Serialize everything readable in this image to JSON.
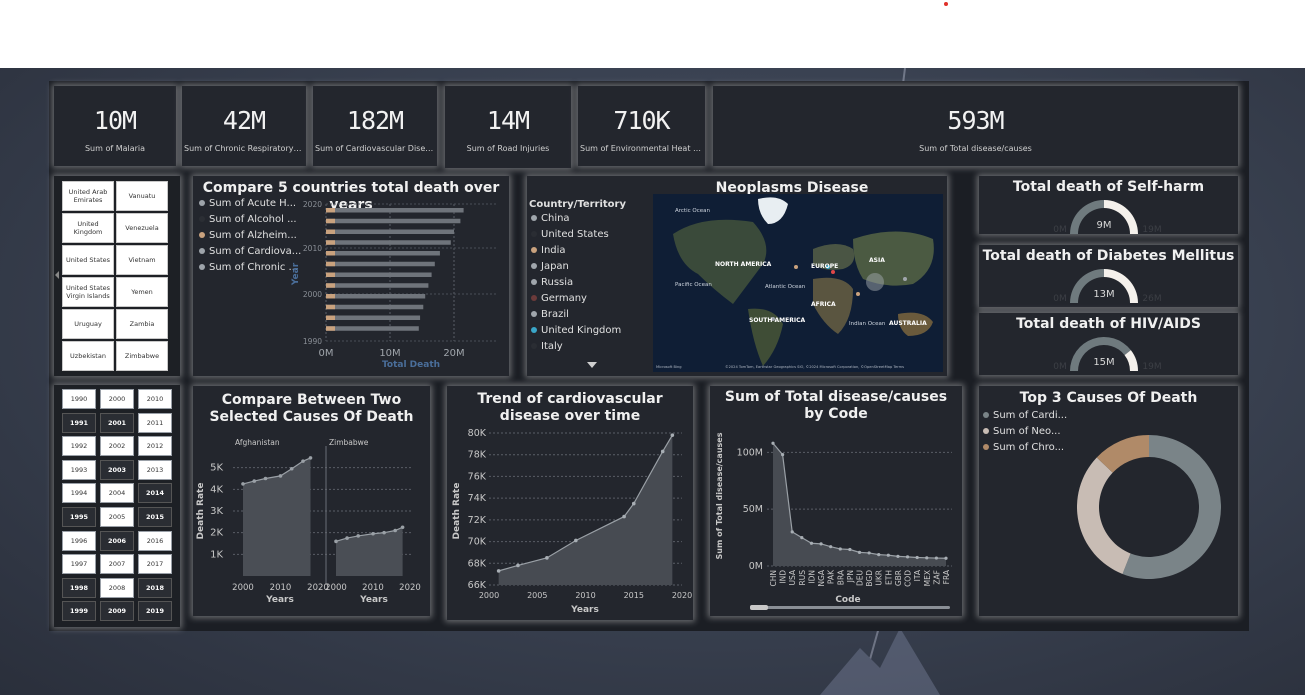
{
  "kpis": [
    {
      "value": "10M",
      "label": "Sum of Malaria"
    },
    {
      "value": "42M",
      "label": "Sum of Chronic Respiratory Dise..."
    },
    {
      "value": "182M",
      "label": "Sum of Cardiovascular Diseases"
    },
    {
      "value": "14M",
      "label": "Sum of Road Injuries"
    },
    {
      "value": "710K",
      "label": "Sum of Environmental Heat and ..."
    },
    {
      "value": "593M",
      "label": "Sum of Total disease/causes"
    }
  ],
  "country_slicer": [
    [
      "United Arab Emirates",
      "Vanuatu"
    ],
    [
      "United Kingdom",
      "Venezuela"
    ],
    [
      "United States",
      "Vietnam"
    ],
    [
      "United States Virgin Islands",
      "Yemen"
    ],
    [
      "Uruguay",
      "Zambia"
    ],
    [
      "Uzbekistan",
      "Zimbabwe"
    ]
  ],
  "year_slicer": {
    "col1": [
      "1990",
      "1991",
      "1992",
      "1993",
      "1994",
      "1995",
      "1996",
      "1997",
      "1998",
      "1999"
    ],
    "col2": [
      "2000",
      "2001",
      "2002",
      "2003",
      "2004",
      "2005",
      "2006",
      "2007",
      "2008",
      "2009"
    ],
    "col3": [
      "2010",
      "2011",
      "2012",
      "2013",
      "2014",
      "2015",
      "2016",
      "2017",
      "2018",
      "2019"
    ],
    "selected": [
      "1991",
      "1995",
      "1998",
      "1999",
      "2001",
      "2003",
      "2006",
      "2009",
      "2014",
      "2015",
      "2018",
      "2019"
    ]
  },
  "compare5": {
    "title": "Compare 5 countries total death over years",
    "legend": [
      "Sum of Acute H...",
      "Sum of Alcohol ...",
      "Sum of Alzheim...",
      "Sum of Cardiova...",
      "Sum of Chronic ..."
    ],
    "legend_colors": [
      "#9ea4aa",
      "#2b2e34",
      "#c9a27e",
      "#9ea4aa",
      "#9ea4aa"
    ],
    "y_label": "Year",
    "x_label": "Total Death",
    "y_ticks": [
      "2020",
      "2010",
      "2000",
      "1990"
    ],
    "x_ticks": [
      "0M",
      "10M",
      "20M"
    ]
  },
  "neoplasms": {
    "title": "Neoplasms Disease",
    "legend_title": "Country/Territory",
    "countries": [
      "China",
      "United States",
      "India",
      "Japan",
      "Russia",
      "Germany",
      "Brazil",
      "United Kingdom",
      "Italy"
    ],
    "country_colors": [
      "#a0a6ac",
      "#2a2d33",
      "#c9a27e",
      "#a0a6ac",
      "#a0a6ac",
      "#6b3a3a",
      "#a0a6ac",
      "#3aa6c8",
      "#2a2d33"
    ],
    "map_labels": [
      "Arctic Ocean",
      "NORTH AMERICA",
      "EUROPE",
      "ASIA",
      "Pacific Ocean",
      "Atlantic Ocean",
      "AFRICA",
      "SOUTH AMERICA",
      "Indian Ocean",
      "AUSTRALIA"
    ],
    "attribution": "©2024 TomTom, Earthstar Geographics SIO, ©2024 Microsoft Corporation, ©OpenStreetMap  Terms",
    "bing": "Microsoft Bing"
  },
  "gauges": [
    {
      "title": "Total death of Self-harm",
      "value": "9M",
      "min": "0M",
      "max": "19M",
      "fill": 0.5
    },
    {
      "title": "Total death of Diabetes Mellitus",
      "value": "13M",
      "min": "0M",
      "max": "26M",
      "fill": 0.5
    },
    {
      "title": "Total death of HIV/AIDS",
      "value": "15M",
      "min": "0M",
      "max": "19M",
      "fill": 0.79
    }
  ],
  "two_causes": {
    "title": "Compare Between Two Selected Causes Of Death",
    "left_country": "Afghanistan",
    "right_country": "Zimbabwe",
    "y_label": "Death Rate",
    "x_label": "Years",
    "y_ticks": [
      "5K",
      "4K",
      "3K",
      "2K",
      "1K"
    ],
    "x_ticks_left": [
      "2000",
      "2010",
      "2020"
    ],
    "x_ticks_right": [
      "2000",
      "2010",
      "2020"
    ]
  },
  "trend": {
    "title": "Trend of cardiovascular disease over time",
    "y_label": "Death Rate",
    "x_label": "Years",
    "y_ticks": [
      "80K",
      "78K",
      "76K",
      "74K",
      "72K",
      "70K",
      "68K",
      "66K"
    ],
    "x_ticks": [
      "2000",
      "2005",
      "2010",
      "2015",
      "2020"
    ]
  },
  "by_code": {
    "title": "Sum of Total disease/causes by Code",
    "y_label": "Sum of Total disease/causes",
    "x_label": "Code",
    "y_ticks": [
      "100M",
      "50M",
      "0M"
    ],
    "codes": [
      "CHN",
      "IND",
      "USA",
      "RUS",
      "IDN",
      "NGA",
      "PAK",
      "BRA",
      "JPN",
      "DEU",
      "BGD",
      "UKR",
      "ETH",
      "GBR",
      "COD",
      "ITA",
      "MEX",
      "ZAF",
      "FRA"
    ]
  },
  "top3": {
    "title": "Top 3 Causes Of Death",
    "legend": [
      "Sum of Cardi...",
      "Sum of Neo...",
      "Sum of Chro..."
    ],
    "colors": [
      "#7a8488",
      "#c8bcb4",
      "#b08a68"
    ]
  },
  "chart_data": [
    {
      "type": "bar",
      "title": "Compare 5 countries total death over years",
      "xlabel": "Total Death",
      "ylabel": "Year",
      "orientation": "horizontal-stacked",
      "xlim": [
        0,
        25000000
      ],
      "series_names": [
        "Sum of Acute H...",
        "Sum of Alcohol ...",
        "Sum of Alzheim...",
        "Sum of Cardiova...",
        "Sum of Chronic ..."
      ],
      "categories": [
        "2019",
        "2018",
        "2015",
        "2014",
        "2009",
        "2006",
        "2003",
        "2001",
        "1999",
        "1998",
        "1995",
        "1991"
      ],
      "totals": [
        21500000,
        21000000,
        20000000,
        19500000,
        17800000,
        17000000,
        16500000,
        16000000,
        15500000,
        15200000,
        14700000,
        14500000
      ]
    },
    {
      "type": "line",
      "title": "Compare Between Two Selected Causes Of Death",
      "xlabel": "Years",
      "ylabel": "Death Rate",
      "series": [
        {
          "name": "Afghanistan",
          "x": [
            2000,
            2003,
            2006,
            2010,
            2013,
            2016,
            2018
          ],
          "values": [
            4250,
            4380,
            4500,
            4620,
            4950,
            5300,
            5450
          ]
        },
        {
          "name": "Zimbabwe",
          "x": [
            2000,
            2003,
            2006,
            2010,
            2013,
            2016,
            2018
          ],
          "values": [
            1600,
            1750,
            1850,
            1950,
            2000,
            2100,
            2250
          ]
        }
      ],
      "ylim": [
        0,
        6000
      ]
    },
    {
      "type": "area",
      "title": "Trend of cardiovascular disease over time",
      "xlabel": "Years",
      "ylabel": "Death Rate",
      "x": [
        2001,
        2003,
        2006,
        2009,
        2014,
        2015,
        2018,
        2019
      ],
      "values": [
        67300,
        67800,
        68500,
        70100,
        72300,
        73500,
        78300,
        79800
      ],
      "ylim": [
        66000,
        80000
      ]
    },
    {
      "type": "area",
      "title": "Sum of Total disease/causes by Code",
      "xlabel": "Code",
      "ylabel": "Sum of Total disease/causes",
      "categories": [
        "CHN",
        "IND",
        "USA",
        "RUS",
        "IDN",
        "NGA",
        "PAK",
        "BRA",
        "JPN",
        "DEU",
        "BGD",
        "UKR",
        "ETH",
        "GBR",
        "COD",
        "ITA",
        "MEX",
        "ZAF",
        "FRA"
      ],
      "values": [
        108000000,
        98000000,
        30000000,
        25000000,
        20000000,
        19500000,
        17000000,
        15000000,
        14500000,
        12000000,
        11500000,
        10000000,
        9500000,
        8500000,
        8000000,
        7500000,
        7200000,
        7000000,
        6800000
      ],
      "ylim": [
        0,
        110000000
      ]
    },
    {
      "type": "pie",
      "title": "Top 3 Causes Of Death",
      "categories": [
        "Sum of Cardi...",
        "Sum of Neo...",
        "Sum of Chro..."
      ],
      "values": [
        182,
        101,
        42
      ]
    }
  ]
}
